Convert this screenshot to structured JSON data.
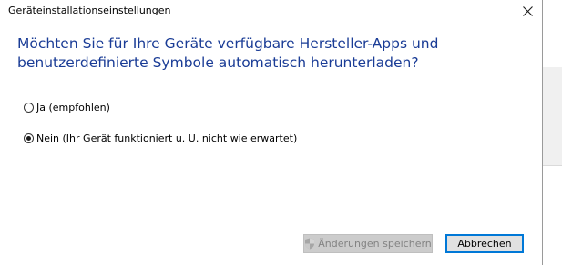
{
  "dialog": {
    "title": "Geräteinstallationseinstellungen",
    "question": "Möchten Sie für Ihre Geräte verfügbare Hersteller-Apps und benutzerdefinierte Symbole automatisch herunterladen?"
  },
  "options": [
    {
      "label": "Ja (empfohlen)",
      "checked": false
    },
    {
      "label": "Nein (Ihr Gerät funktioniert u. U. nicht wie erwartet)",
      "checked": true
    }
  ],
  "buttons": {
    "save_label": "Änderungen speichern",
    "save_enabled": false,
    "cancel_label": "Abbrechen"
  },
  "icons": {
    "close": "close-icon",
    "uac_shield": "shield-icon"
  },
  "colors": {
    "heading": "#1a3c96",
    "focus_border": "#0078d7",
    "disabled_button": "#cccccc"
  }
}
